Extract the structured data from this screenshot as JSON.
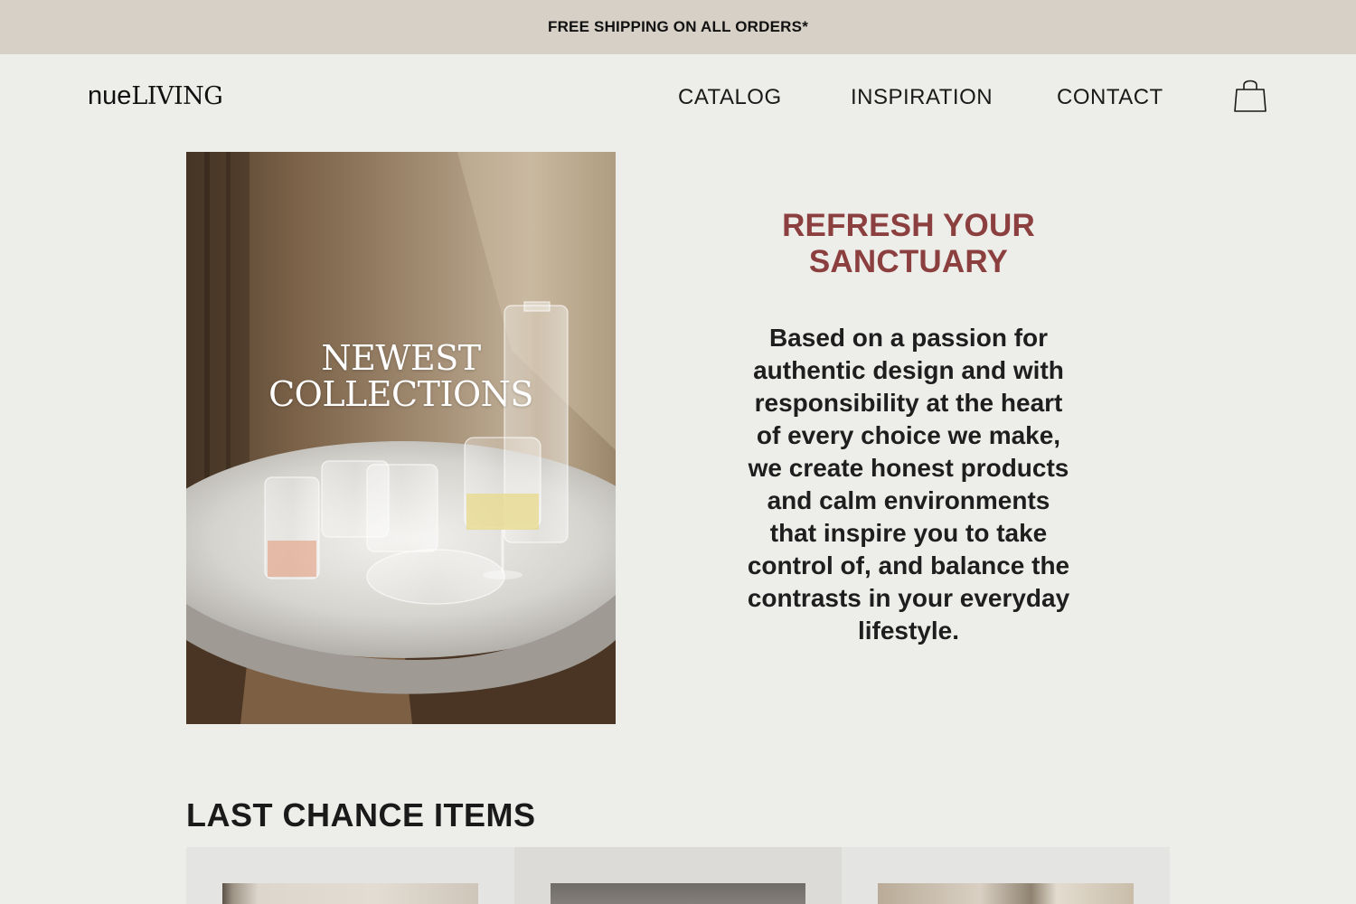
{
  "announcement": {
    "text": "FREE SHIPPING ON ALL ORDERS*"
  },
  "header": {
    "logo_prefix": "nue",
    "logo_suffix": "LIVING",
    "nav": [
      {
        "label": "CATALOG"
      },
      {
        "label": "INSPIRATION"
      },
      {
        "label": "CONTACT"
      }
    ],
    "cart_icon": "shopping-bag-icon"
  },
  "hero": {
    "image_caption_line1": "NEWEST",
    "image_caption_line2": "COLLECTIONS",
    "title": "REFRESH YOUR SANCTUARY",
    "body": "Based on a passion for authentic design and with responsibility at the heart of every choice we make, we create honest products and calm environments that inspire you to take control of, and balance the contrasts in your everyday lifestyle."
  },
  "last_chance": {
    "title": "LAST CHANCE ITEMS",
    "items": [
      {},
      {},
      {}
    ]
  },
  "colors": {
    "background": "#edede9",
    "announcement_bg": "#d6d0c7",
    "accent_title": "#8c3f3f",
    "text": "#1a1a1a"
  }
}
